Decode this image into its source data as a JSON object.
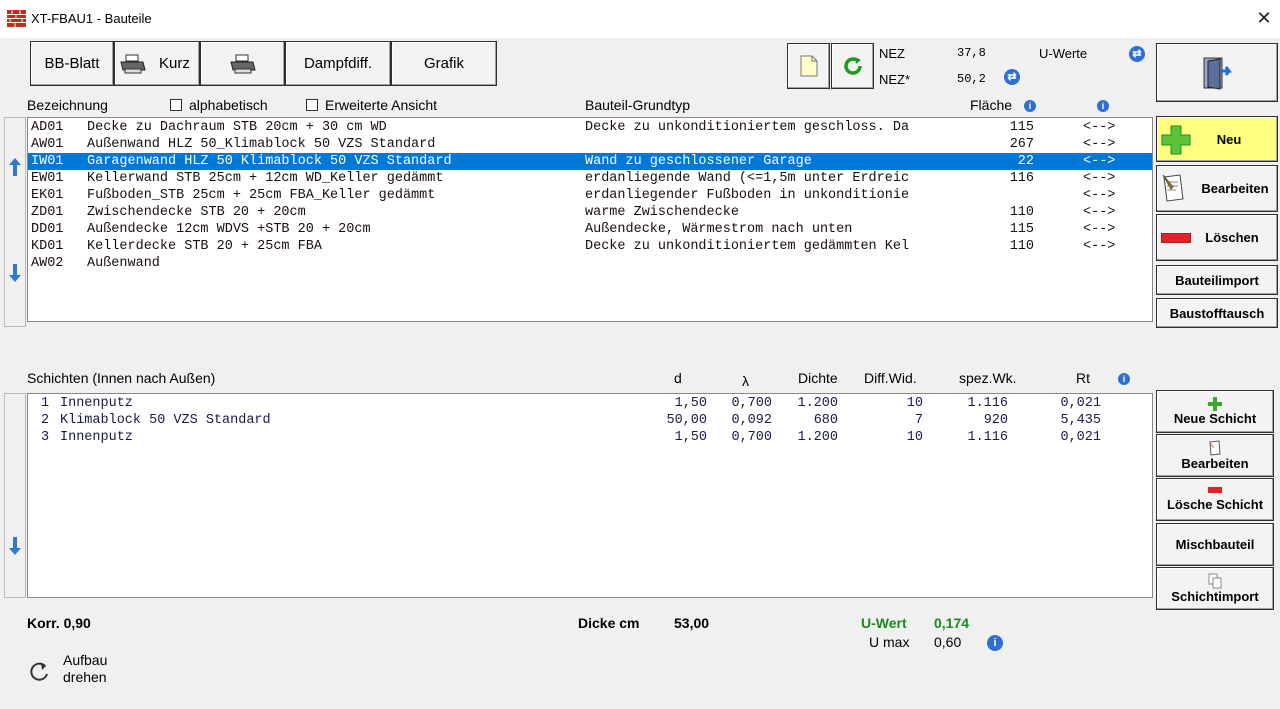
{
  "window": {
    "title": "XT-FBAU1 - Bauteile",
    "close": "✕"
  },
  "toolbar": {
    "bb_blatt": "BB-Blatt",
    "kurz": "Kurz",
    "dampfdiff": "Dampfdiff.",
    "grafik": "Grafik"
  },
  "nez": {
    "nez_label": "NEZ",
    "nez_value": "37,8",
    "nez_star_label": "NEZ*",
    "nez_star_value": "50,2",
    "u_werte": "U-Werte"
  },
  "list_header": {
    "bezeichnung": "Bezeichnung",
    "alphabetisch": "alphabetisch",
    "erweiterte": "Erweiterte Ansicht",
    "grundtyp": "Bauteil-Grundtyp",
    "flaeche": "Fläche"
  },
  "components": [
    {
      "code": "AD01",
      "name": "Decke zu Dachraum STB 20cm + 30 cm WD",
      "type": "Decke zu unkonditioniertem geschloss. Da",
      "area": "115",
      "link": "<-->"
    },
    {
      "code": "AW01",
      "name": "Außenwand HLZ 50_Klimablock 50 VZS Standard",
      "type": "",
      "area": "267",
      "link": "<-->"
    },
    {
      "code": "IW01",
      "name": "Garagenwand HLZ 50 Klimablock 50 VZS Standard",
      "type": "Wand zu geschlossener Garage",
      "area": "22",
      "link": "<-->"
    },
    {
      "code": "EW01",
      "name": "Kellerwand STB 25cm + 12cm WD_Keller gedämmt",
      "type": "erdanliegende Wand (<=1,5m unter Erdreic",
      "area": "116",
      "link": "<-->"
    },
    {
      "code": "EK01",
      "name": "Fußboden_STB 25cm + 25cm FBA_Keller gedämmt",
      "type": "erdanliegender Fußboden in unkonditionie",
      "area": "",
      "link": "<-->"
    },
    {
      "code": "ZD01",
      "name": "Zwischendecke STB 20 + 20cm",
      "type": "warme Zwischendecke",
      "area": "110",
      "link": "<-->"
    },
    {
      "code": "DD01",
      "name": "Außendecke 12cm WDVS +STB 20 + 20cm",
      "type": "Außendecke, Wärmestrom nach unten",
      "area": "115",
      "link": "<-->"
    },
    {
      "code": "KD01",
      "name": "Kellerdecke STB 20 + 25cm FBA",
      "type": "Decke zu unkonditioniertem gedämmten Kel",
      "area": "110",
      "link": "<-->"
    },
    {
      "code": "AW02",
      "name": "Außenwand",
      "type": "",
      "area": "",
      "link": ""
    }
  ],
  "right_buttons": {
    "neu": "Neu",
    "bearbeiten": "Bearbeiten",
    "loeschen": "Löschen",
    "bauteilimport": "Bauteilimport",
    "baustofftausch": "Baustofftausch"
  },
  "layers_header": {
    "schichten": "Schichten (Innen nach Außen)",
    "d": "d",
    "lambda": "λ",
    "dichte": "Dichte",
    "diff": "Diff.Wid.",
    "spez": "spez.Wk.",
    "rt": "Rt"
  },
  "layers": [
    {
      "nr": "1",
      "name": "Innenputz",
      "d": "1,50",
      "lambda": "0,700",
      "dichte": "1.200",
      "diff": "10",
      "spez": "1.116",
      "rt": "0,021"
    },
    {
      "nr": "2",
      "name": "Klimablock 50 VZS Standard",
      "d": "50,00",
      "lambda": "0,092",
      "dichte": "680",
      "diff": "7",
      "spez": "920",
      "rt": "5,435"
    },
    {
      "nr": "3",
      "name": "Innenputz",
      "d": "1,50",
      "lambda": "0,700",
      "dichte": "1.200",
      "diff": "10",
      "spez": "1.116",
      "rt": "0,021"
    }
  ],
  "layer_buttons": {
    "neue_schicht": "Neue Schicht",
    "bearbeiten": "Bearbeiten",
    "loesche": "Lösche Schicht",
    "mischbauteil": "Mischbauteil",
    "schichtimport": "Schichtimport"
  },
  "footer": {
    "korr": "Korr. 0,90",
    "dicke_label": "Dicke cm",
    "dicke_value": "53,00",
    "uwert_label": "U-Wert",
    "uwert_value": "0,174",
    "umax_label": "U max",
    "umax_value": "0,60",
    "aufbau_line1": "Aufbau",
    "aufbau_line2": "drehen"
  },
  "colors": {
    "selection": "#0078d7",
    "neu_button": "#ffff80",
    "uwert": "#1a8a1a",
    "info": "#2e6fd6"
  }
}
